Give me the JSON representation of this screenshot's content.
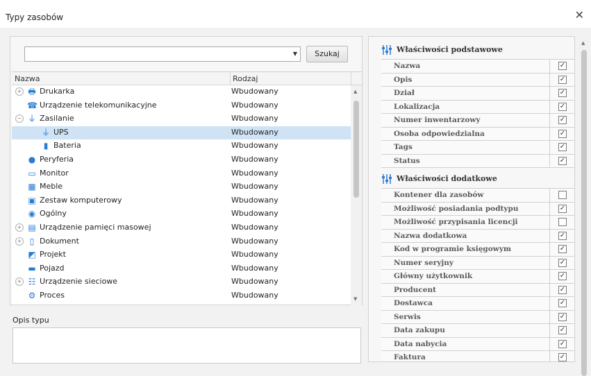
{
  "window": {
    "title": "Typy zasobów",
    "close_glyph": "✕"
  },
  "search": {
    "value": "",
    "button_label": "Szukaj"
  },
  "grid": {
    "columns": [
      "Nazwa",
      "Rodzaj"
    ],
    "rows": [
      {
        "name": "Drukarka",
        "kind": "Wbudowany",
        "icon": "printer-icon",
        "expander": "+"
      },
      {
        "name": "Urządzenie telekomunikacyjne",
        "kind": "Wbudowany",
        "icon": "fax-icon",
        "expander": ""
      },
      {
        "name": "Zasilanie",
        "kind": "Wbudowany",
        "icon": "plug-icon",
        "expander": "−"
      },
      {
        "name": "UPS",
        "kind": "Wbudowany",
        "icon": "plug-icon",
        "expander": "",
        "selected": true
      },
      {
        "name": "Bateria",
        "kind": "Wbudowany",
        "icon": "battery-icon",
        "expander": ""
      },
      {
        "name": "Peryferia",
        "kind": "Wbudowany",
        "icon": "mouse-icon",
        "expander": ""
      },
      {
        "name": "Monitor",
        "kind": "Wbudowany",
        "icon": "monitor-icon",
        "expander": ""
      },
      {
        "name": "Meble",
        "kind": "Wbudowany",
        "icon": "furniture-icon",
        "expander": ""
      },
      {
        "name": "Zestaw komputerowy",
        "kind": "Wbudowany",
        "icon": "computer-icon",
        "expander": ""
      },
      {
        "name": "Ogólny",
        "kind": "Wbudowany",
        "icon": "general-icon",
        "expander": ""
      },
      {
        "name": "Urządzenie pamięci masowej",
        "kind": "Wbudowany",
        "icon": "storage-icon",
        "expander": "+"
      },
      {
        "name": "Dokument",
        "kind": "Wbudowany",
        "icon": "document-icon",
        "expander": "+"
      },
      {
        "name": "Projekt",
        "kind": "Wbudowany",
        "icon": "project-icon",
        "expander": ""
      },
      {
        "name": "Pojazd",
        "kind": "Wbudowany",
        "icon": "vehicle-icon",
        "expander": ""
      },
      {
        "name": "Urządzenie sieciowe",
        "kind": "Wbudowany",
        "icon": "network-icon",
        "expander": "+"
      },
      {
        "name": "Proces",
        "kind": "Wbudowany",
        "icon": "gears-icon",
        "expander": ""
      }
    ]
  },
  "description": {
    "label": "Opis typu",
    "value": ""
  },
  "basic_props": {
    "title": "Właściwości podstawowe",
    "items": [
      {
        "name": "Nazwa",
        "checked": true
      },
      {
        "name": "Opis",
        "checked": true
      },
      {
        "name": "Dział",
        "checked": true
      },
      {
        "name": "Lokalizacja",
        "checked": true
      },
      {
        "name": "Numer inwentarzowy",
        "checked": true
      },
      {
        "name": "Osoba odpowiedzialna",
        "checked": true
      },
      {
        "name": "Tags",
        "checked": true
      },
      {
        "name": "Status",
        "checked": true
      }
    ]
  },
  "extra_props": {
    "title": "Właściwości dodatkowe",
    "items": [
      {
        "name": "Kontener dla zasobów",
        "checked": false
      },
      {
        "name": "Możliwość posiadania podtypu",
        "checked": true
      },
      {
        "name": "Możliwość przypisania licencji",
        "checked": false
      },
      {
        "name": "Nazwa dodatkowa",
        "checked": true
      },
      {
        "name": "Kod w programie księgowym",
        "checked": true
      },
      {
        "name": "Numer seryjny",
        "checked": true
      },
      {
        "name": "Główny użytkownik",
        "checked": true
      },
      {
        "name": "Producent",
        "checked": true
      },
      {
        "name": "Dostawca",
        "checked": true
      },
      {
        "name": "Serwis",
        "checked": true
      },
      {
        "name": "Data zakupu",
        "checked": true
      },
      {
        "name": "Data nabycia",
        "checked": true
      },
      {
        "name": "Faktura",
        "checked": true
      }
    ]
  },
  "colors": {
    "selection": "#cfe3f5",
    "icon_blue": "#2a7bd4"
  }
}
